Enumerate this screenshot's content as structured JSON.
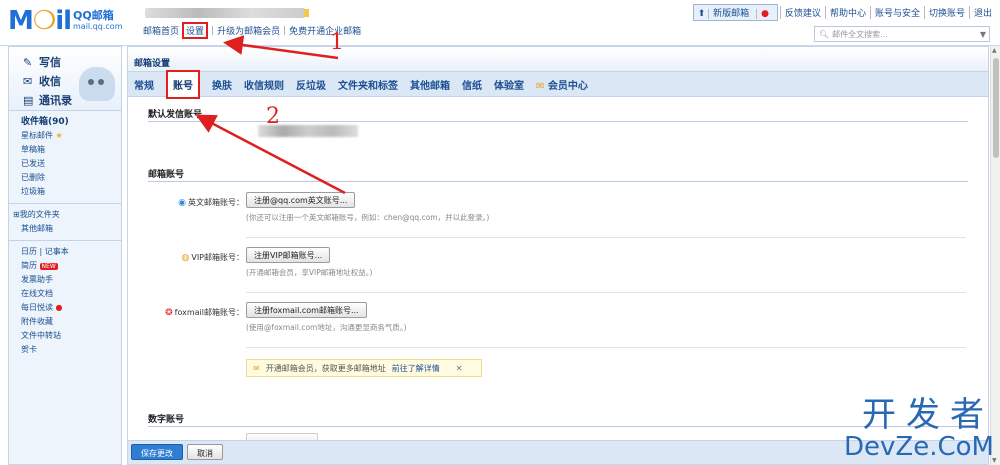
{
  "app": {
    "logo_text": "Mail",
    "logo_title": "QQ邮箱",
    "logo_domain": "mail.qq.com"
  },
  "toplinks": [
    "邮箱首页",
    "设置",
    "升级为邮箱会员",
    "免费开通企业邮箱"
  ],
  "rightlinks": {
    "new_version": "新版邮箱",
    "items": [
      "反馈建议",
      "帮助中心",
      "账号与安全",
      "切换账号",
      "退出"
    ]
  },
  "search": {
    "placeholder": "邮件全文搜索..."
  },
  "left": {
    "actions": [
      "写信",
      "收信",
      "通讯录"
    ],
    "folders": [
      "收件箱(90)",
      "星标邮件",
      "草稿箱",
      "已发送",
      "已删除",
      "垃圾箱"
    ],
    "my_folders": [
      "我的文件夹",
      "其他邮箱"
    ],
    "tools": [
      "日历",
      "记事本",
      "简历",
      "发票助手",
      "在线文档",
      "每日悦读",
      "附件收藏",
      "文件中转站",
      "贺卡"
    ],
    "new_badge": "NEW"
  },
  "main": {
    "title": "邮箱设置",
    "tabs": [
      "常规",
      "账号",
      "换肤",
      "收信规则",
      "反垃圾",
      "文件夹和标签",
      "其他邮箱",
      "信纸",
      "体验室",
      "会员中心"
    ],
    "default_sender_title": "默认发信账号",
    "mailbox_accounts_title": "邮箱账号",
    "numeric_account_title": "数字账号",
    "rows": [
      {
        "label": "英文邮箱账号：",
        "button": "注册@qq.com英文账号...",
        "hint": "(你还可以注册一个英文邮箱账号，例如：chen@qq.com，并以此登录。)"
      },
      {
        "label": "VIP邮箱账号：",
        "button": "注册VIP邮箱账号...",
        "hint": "(开通邮箱会员，享VIP邮箱地址权益。)"
      },
      {
        "label": "foxmail邮箱账号：",
        "button": "注册foxmail.com邮箱账号...",
        "hint": "(使用@foxmail.com地址，沟通更显商务气质。)"
      }
    ],
    "promo": {
      "text": "开通邮箱会员，获取更多邮箱地址",
      "link": "前往了解详情",
      "close": "✕"
    },
    "footer": {
      "save": "保存更改",
      "cancel": "取消"
    }
  },
  "annotations": {
    "one": "1",
    "two": "2"
  },
  "watermark": {
    "line1": "开发者",
    "line2": "DevZe.CoM"
  },
  "colors": {
    "accent": "#1e6fd6",
    "highlight": "#e02020",
    "tabbar": "#dbe7f5"
  }
}
